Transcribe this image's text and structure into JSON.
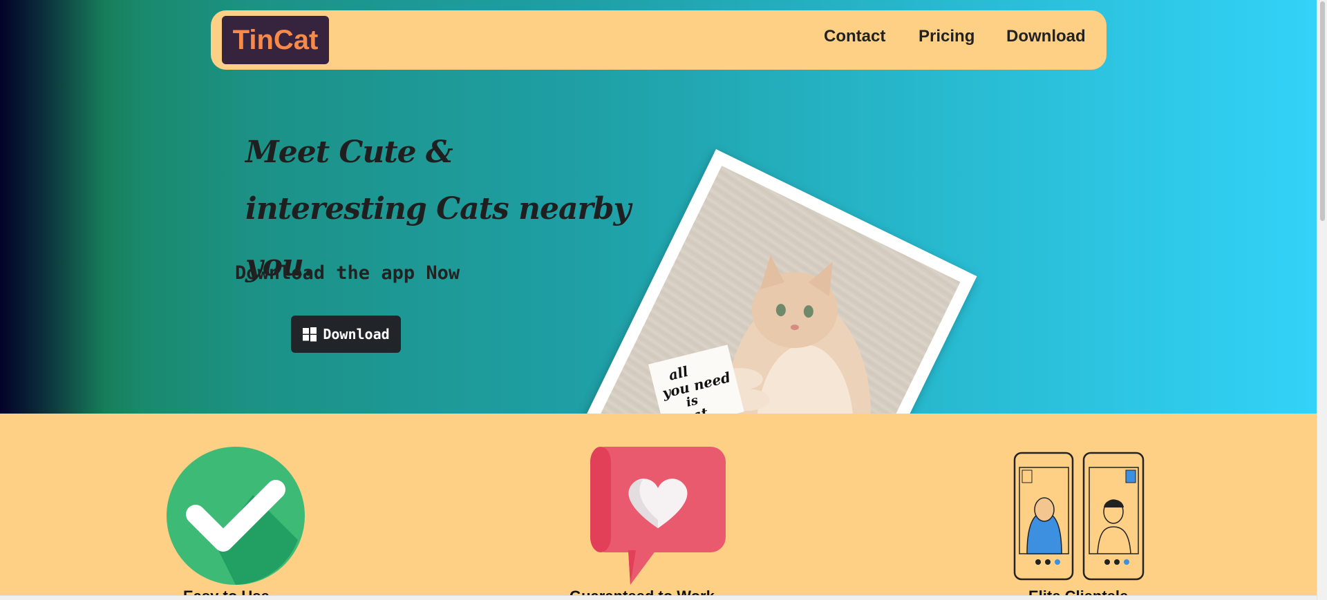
{
  "brand": {
    "name": "TinCat",
    "bg": "#36243f",
    "color": "#f7894a"
  },
  "nav": {
    "contact": "Contact",
    "pricing": "Pricing",
    "download": "Download"
  },
  "hero": {
    "headline": "Meet Cute & interesting Cats nearby you.",
    "subhead": "Download the app Now",
    "download_button": "Download",
    "photo_card_text": "all you need is cat"
  },
  "features": [
    {
      "title": "Easy to Use",
      "icon": "check-circle-icon"
    },
    {
      "title": "Guaranteed to Work",
      "icon": "heart-chat-icon"
    },
    {
      "title": "Elite Clientele",
      "icon": "video-call-phones-icon"
    }
  ],
  "colors": {
    "section_bg": "#fdd085",
    "button_bg": "#212529",
    "check_green": "#3dba76",
    "heart_red": "#ea5a6f"
  }
}
